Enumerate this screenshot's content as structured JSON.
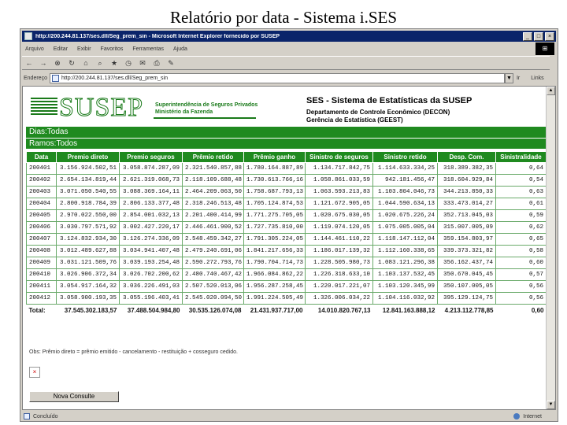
{
  "slide_title": "Relatório por data - Sistema i.SES",
  "window": {
    "title": "http://200.244.81.137/ses.dll/Seg_prem_sin - Microsoft Internet Explorer fornecido por SUSEP",
    "menu": [
      "Arquivo",
      "Editar",
      "Exibir",
      "Favoritos",
      "Ferramentas",
      "Ajuda"
    ],
    "address_label": "Endereço",
    "address_value": "http://200.244.81.137/ses.dll/Seg_prem_sin",
    "go_label": "Ir",
    "links_label": "Links",
    "status_text": "Concluído",
    "zone_text": "Internet"
  },
  "page": {
    "logo_text": "SUSEP",
    "logo_sub1": "Superintendência de Seguros Privados",
    "logo_sub2": "Ministério da Fazenda",
    "ses_title": "SES - Sistema de Estatísticas da SUSEP",
    "ses_dept": "Departamento de Controle Econômico (DECON)",
    "ses_ger": "Gerência de Estatística (GEEST)",
    "band_dias": "Dias:Todas",
    "band_ramos": "Ramos:Todos",
    "headers": [
      "Data",
      "Premio direto",
      "Premio seguros",
      "Prêmio retido",
      "Prêmio ganho",
      "Sinistro de seguros",
      "Sinistro retido",
      "Desp. Com.",
      "Sinistralidade"
    ],
    "rows": [
      [
        "200401",
        "3.156.924.502,51",
        "3.058.874.287,09",
        "2.321.540.857,88",
        "1.780.164.887,89",
        "1.134.717.842,75",
        "1.114.633.334,25",
        "318.389.382,35",
        "0,64"
      ],
      [
        "200402",
        "2.654.134.819,44",
        "2.621.319.068,73",
        "2.118.109.688,48",
        "1.730.613.766,16",
        "1.058.861.033,59",
        "942.181.456,47",
        "318.604.929,84",
        "0,54"
      ],
      [
        "200403",
        "3.071.050.540,55",
        "3.088.369.164,11",
        "2.464.209.063,50",
        "1.758.687.793,13",
        "1.063.593.213,83",
        "1.103.804.046,73",
        "344.213.850,33",
        "0,63"
      ],
      [
        "200404",
        "2.800.918.784,39",
        "2.806.133.377,48",
        "2.318.246.513,48",
        "1.705.124.874,53",
        "1.121.672.905,05",
        "1.044.590.634,13",
        "333.473.014,27",
        "0,61"
      ],
      [
        "200405",
        "2.970.022.550,00",
        "2.854.001.032,13",
        "2.201.400.414,99",
        "1.771.275.705,05",
        "1.020.675.030,05",
        "1.020.675.226,24",
        "352.713.045,03",
        "0,59"
      ],
      [
        "200406",
        "3.030.797.571,92",
        "3.002.427.220,17",
        "2.446.461.900,52",
        "1.727.735.810,00",
        "1.119.074.120,05",
        "1.075.005.005,04",
        "315.007.005,09",
        "0,62"
      ],
      [
        "200407",
        "3.124.832.934,30",
        "3.126.274.336,09",
        "2.548.459.342,27",
        "1.791.305.224,05",
        "1.144.461.110,22",
        "1.118.147.112,04",
        "359.154.803,97",
        "0,65"
      ],
      [
        "200408",
        "3.012.489.627,88",
        "3.034.941.407,48",
        "2.479.240.691,06",
        "1.841.217.656,33",
        "1.186.017.139,32",
        "1.112.160.338,65",
        "339.373.321,82",
        "0,58"
      ],
      [
        "200409",
        "3.031.121.509,76",
        "3.039.193.254,48",
        "2.590.272.793,76",
        "1.790.704.714,73",
        "1.228.505.980,73",
        "1.083.121.296,38",
        "356.162.437,74",
        "0,60"
      ],
      [
        "200410",
        "3.026.906.372,34",
        "3.026.702.200,62",
        "2.480.740.467,42",
        "1.966.084.862,22",
        "1.226.318.633,10",
        "1.103.137.532,45",
        "350.670.045,45",
        "0,57"
      ],
      [
        "200411",
        "3.054.917.164,32",
        "3.036.226.491,03",
        "2.507.520.013,06",
        "1.956.287.258,45",
        "1.220.017.221,07",
        "1.103.120.345,99",
        "350.107.005,05",
        "0,56"
      ],
      [
        "200412",
        "3.058.900.193,35",
        "3.055.196.403,41",
        "2.545.020.094,50",
        "1.991.224.505,49",
        "1.326.006.034,22",
        "1.104.116.032,92",
        "395.129.124,75",
        "0,56"
      ]
    ],
    "total": [
      "Total:",
      "37.545.302.183,57",
      "37.488.504.984,80",
      "30.535.126.074,08",
      "21.431.937.717,00",
      "14.010.820.767,13",
      "12.841.163.888,12",
      "4.213.112.778,85",
      "0,60"
    ],
    "obs": "Obs: Prêmio direto = prêmio emitido - cancelamento - restituição + cosseguro cedido.",
    "button_label": "Nova Consulte"
  }
}
